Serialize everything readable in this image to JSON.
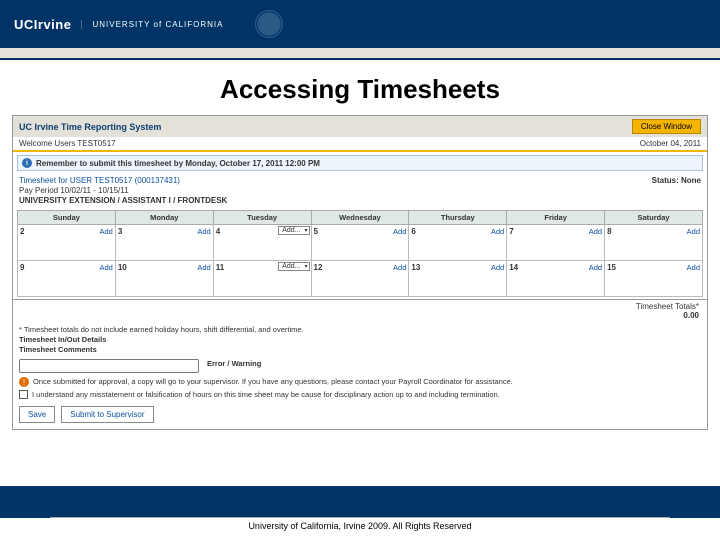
{
  "brand": {
    "logo": "UCIrvine",
    "sub": "UNIVERSITY of CALIFORNIA"
  },
  "slide_title": "Accessing Timesheets",
  "trs": {
    "system_name": "UC Irvine Time Reporting System",
    "close": "Close Window",
    "welcome": "Welcome Users TEST0517",
    "today": "October 04, 2011",
    "reminder": "Remember to submit this timesheet by Monday, October 17, 2011 12:00 PM",
    "ts_for": "Timesheet for USER TEST0517 (000137431)",
    "pay_period": "Pay Period 10/02/11 - 10/15/11",
    "dept": "UNIVERSITY EXTENSION / ASSISTANT I / FRONTDESK",
    "status_label": "Status:",
    "status_value": "None",
    "days": [
      "Sunday",
      "Monday",
      "Tuesday",
      "Wednesday",
      "Thursday",
      "Friday",
      "Saturday"
    ],
    "week1": [
      {
        "n": "2",
        "add": "Add",
        "hl": false,
        "sel": false
      },
      {
        "n": "3",
        "add": "Add",
        "hl": false,
        "sel": false
      },
      {
        "n": "4",
        "add": "Add...",
        "hl": true,
        "sel": true
      },
      {
        "n": "5",
        "add": "Add",
        "hl": true,
        "sel": false
      },
      {
        "n": "6",
        "add": "Add",
        "hl": true,
        "sel": false
      },
      {
        "n": "7",
        "add": "Add",
        "hl": true,
        "sel": false
      },
      {
        "n": "8",
        "add": "Add",
        "hl": true,
        "sel": false
      }
    ],
    "week2": [
      {
        "n": "9",
        "add": "Add",
        "hl": true,
        "sel": false
      },
      {
        "n": "10",
        "add": "Add",
        "hl": true,
        "sel": false
      },
      {
        "n": "11",
        "add": "Add...",
        "hl": true,
        "sel": true
      },
      {
        "n": "12",
        "add": "Add",
        "hl": true,
        "sel": false
      },
      {
        "n": "13",
        "add": "Add",
        "hl": true,
        "sel": false
      },
      {
        "n": "14",
        "add": "Add",
        "hl": true,
        "sel": false
      },
      {
        "n": "15",
        "add": "Add",
        "hl": true,
        "sel": false
      }
    ],
    "totals_label": "Timesheet Totals*",
    "totals_value": "0.00",
    "footnote": "* Timesheet totals do not include earned holiday hours, shift differential, and overtime.",
    "inout_label": "Timesheet In/Out Details",
    "comments_label": "Timesheet Comments",
    "error_header": "Error / Warning",
    "disclaimer": "Once submitted for approval, a copy will go to your supervisor. If you have any questions, please contact your Payroll Coordinator for assistance.",
    "ack": "I understand any misstatement or falsification of hours on this time sheet may be cause for disciplinary action up to and including termination.",
    "save": "Save",
    "submit": "Submit to Supervisor"
  },
  "footer": "University of California, Irvine 2009. All Rights Reserved"
}
